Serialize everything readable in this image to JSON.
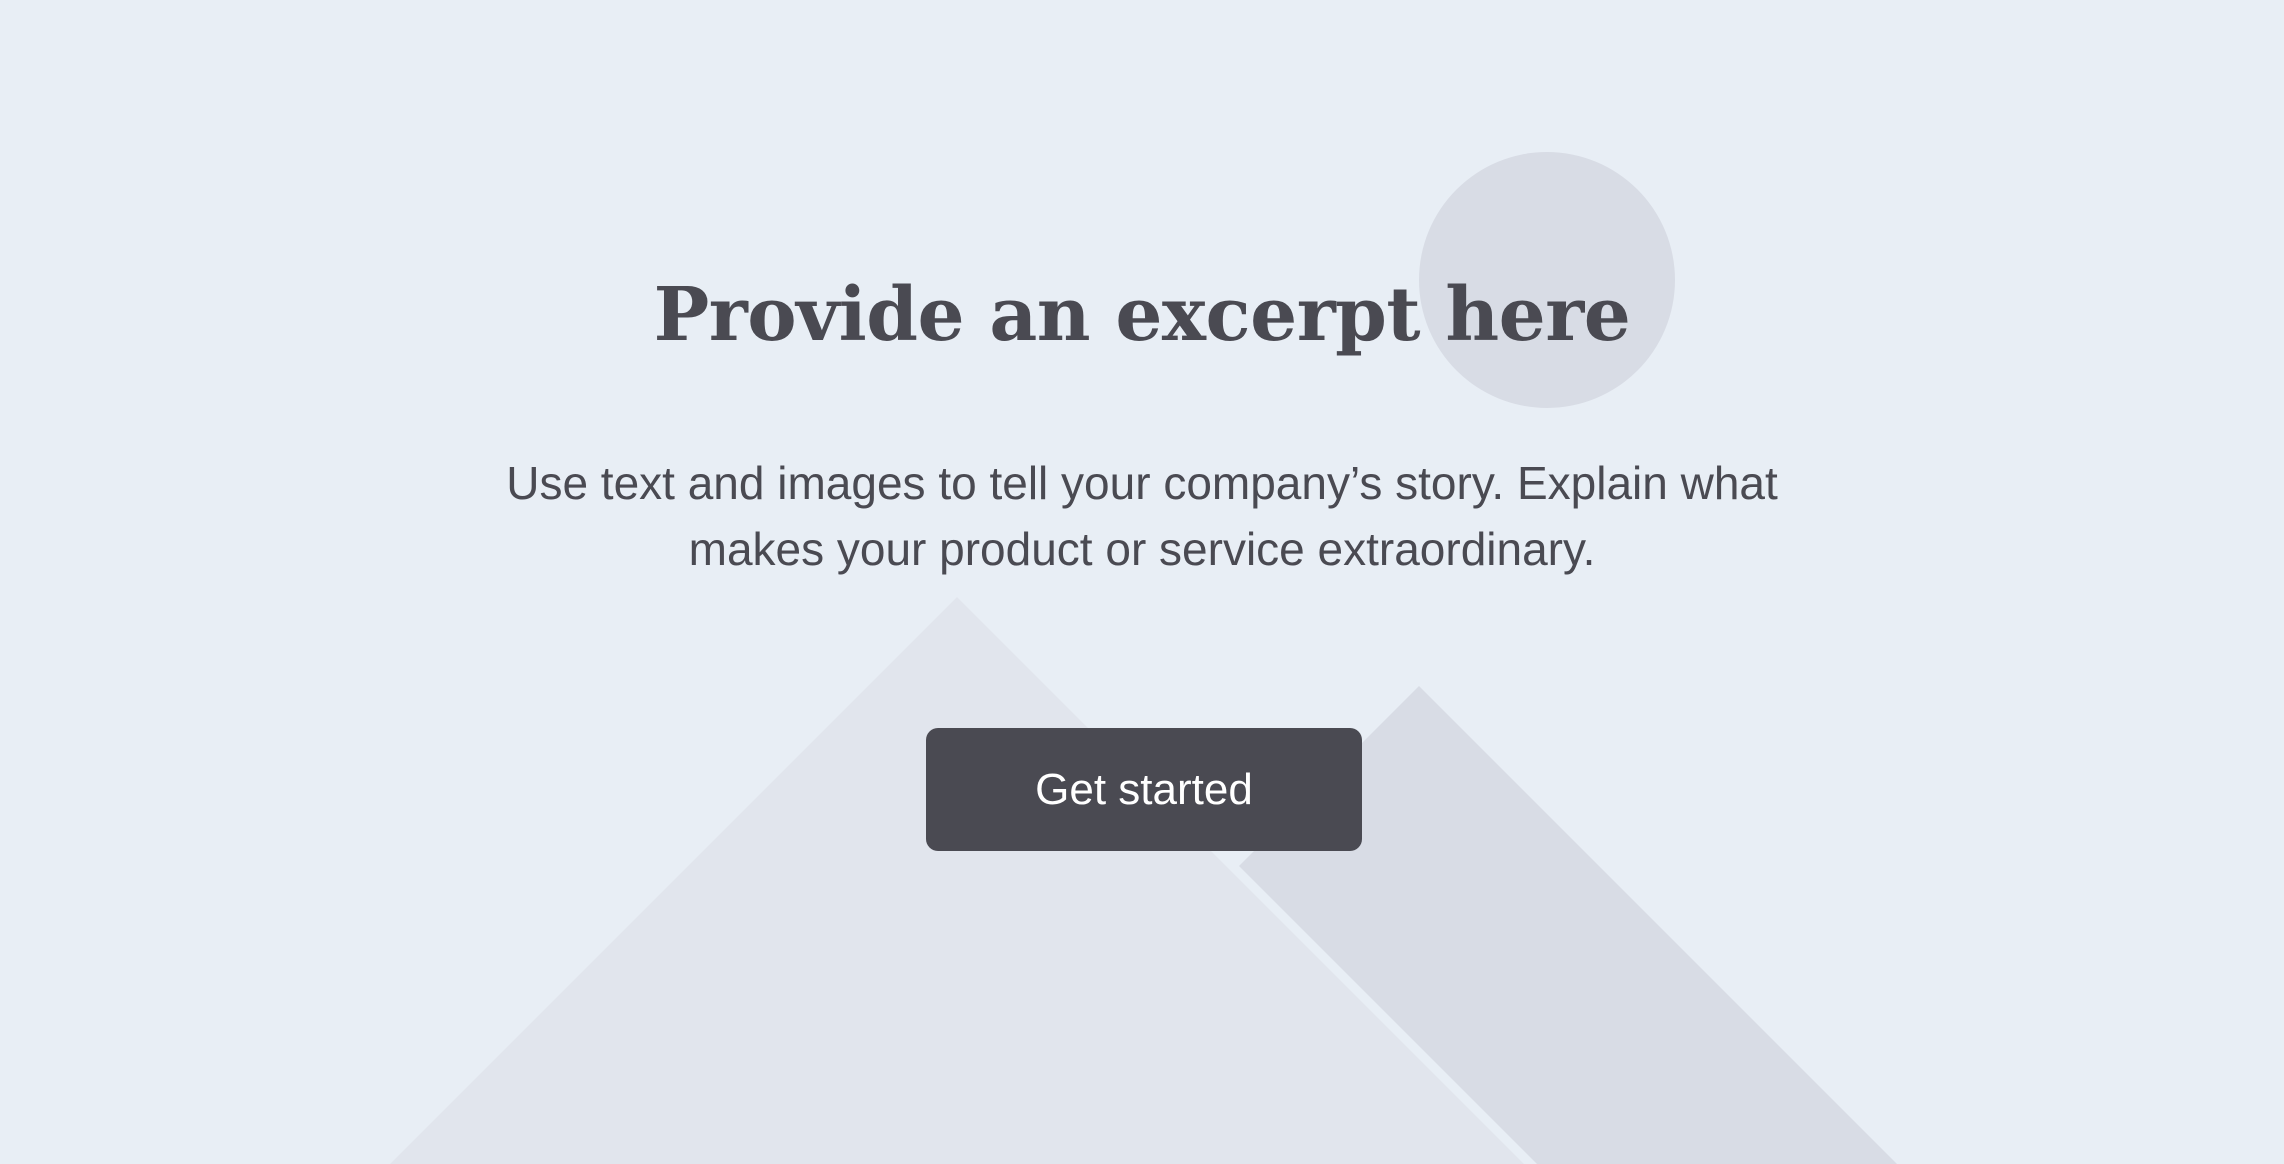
{
  "hero": {
    "title": "Provide an excerpt here",
    "description": "Use text and images to tell your company’s story. Explain what makes your product or service extraordinary.",
    "cta_label": "Get started"
  },
  "colors": {
    "background": "#e8eef5",
    "mountain_front": "#e1e5ed",
    "mountain_back": "#d8dce5",
    "sun": "#d8dce5",
    "text": "#4a4a52",
    "button": "#4a4a52"
  },
  "icons": {
    "illustration": "mountains-and-sun-placeholder"
  }
}
